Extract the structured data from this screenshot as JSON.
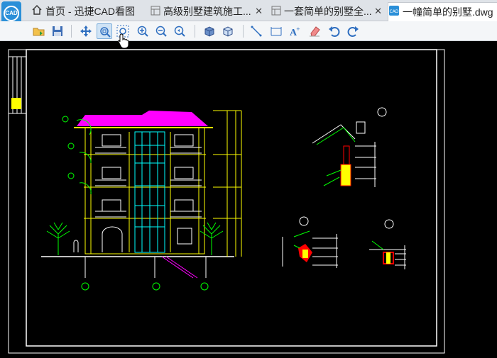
{
  "tabs": [
    {
      "label": "首页 - 迅捷CAD看图",
      "icon": "home-icon",
      "closable": false,
      "active": false
    },
    {
      "label": "高级别墅建筑施工...",
      "icon": "drawing-tab-icon",
      "closable": true,
      "active": false
    },
    {
      "label": "一套简单的别墅全...",
      "icon": "drawing-tab-icon",
      "closable": true,
      "active": false
    },
    {
      "label": "一幢简单的别墅.dwg",
      "icon": "cad-file-icon",
      "closable": false,
      "active": true
    }
  ],
  "app_logo_text": "CAD",
  "toolbar": [
    "open-file-icon",
    "save-icon",
    "pan-icon",
    "zoom-window-icon",
    "zoom-extents-icon",
    "zoom-in-icon",
    "zoom-out-icon",
    "zoom-previous-icon",
    "view-3d-icon",
    "view-iso-icon",
    "measure-line-icon",
    "dimension-icon",
    "text-icon",
    "eraser-icon",
    "undo-icon",
    "redo-icon"
  ],
  "colors": {
    "canvas": "#000000",
    "roof": "#ff00ff",
    "dim": "#ffff00",
    "glass": "#00ffff",
    "tree": "#00ff00",
    "wall": "#ffffff",
    "detail": "#ff0000"
  }
}
